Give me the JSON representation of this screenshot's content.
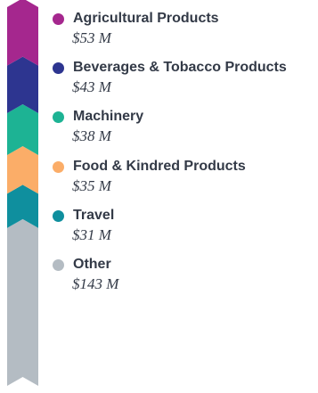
{
  "chart_data": {
    "type": "stacked-bar",
    "title": "",
    "orientation": "vertical",
    "legend_position": "right",
    "unit": "M",
    "series": [
      {
        "name": "Agricultural Products",
        "value": 53,
        "label": "$53 M",
        "color": "#a5278e"
      },
      {
        "name": "Beverages & Tobacco Products",
        "value": 43,
        "label": "$43 M",
        "color": "#2d3590"
      },
      {
        "name": "Machinery",
        "value": 38,
        "label": "$38 M",
        "color": "#1db394"
      },
      {
        "name": "Food & Kindred Products",
        "value": 35,
        "label": "$35 M",
        "color": "#fbad68"
      },
      {
        "name": "Travel",
        "value": 31,
        "label": "$31 M",
        "color": "#0f8f9e"
      },
      {
        "name": "Other",
        "value": 143,
        "label": "$143 M",
        "color": "#b4bcc3"
      }
    ]
  }
}
